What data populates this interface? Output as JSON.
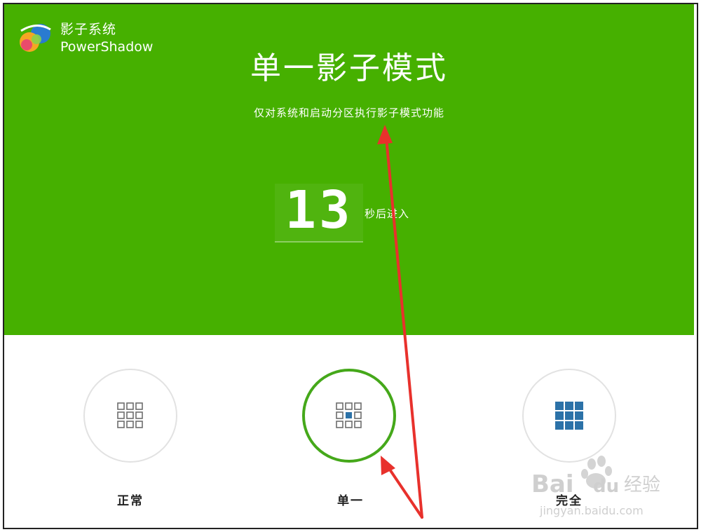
{
  "app": {
    "name_cn": "影子系统",
    "name_en": "PowerShadow"
  },
  "header": {
    "mode_title": "单一影子模式",
    "mode_description": "仅对系统和启动分区执行影子模式功能"
  },
  "countdown": {
    "seconds": "13",
    "label": "秒后进入"
  },
  "modes": [
    {
      "label": "正常",
      "icon": "grid-outline-icon",
      "selected": false
    },
    {
      "label": "单一",
      "icon": "grid-single-icon",
      "selected": true
    },
    {
      "label": "完全",
      "icon": "grid-filled-icon",
      "selected": false
    }
  ],
  "watermark": {
    "brand": "Bai",
    "brand_tail": "du",
    "brand_cn": "经验",
    "url": "jingyan.baidu.com"
  },
  "colors": {
    "accent_green": "#46b000",
    "selected_ring": "#45a81a",
    "icon_blue": "#2c72a8",
    "annotation_red": "#e8312c"
  }
}
